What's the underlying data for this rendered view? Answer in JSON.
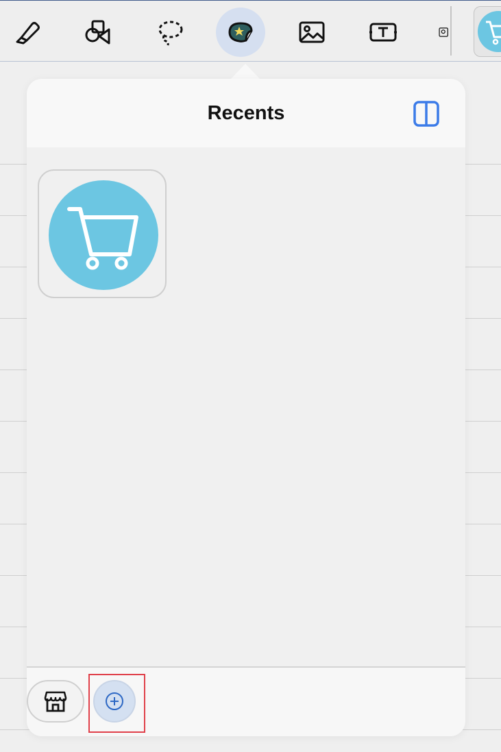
{
  "toolbar": {
    "tools": [
      {
        "name": "highlighter-tool",
        "icon": "highlighter-icon"
      },
      {
        "name": "shapes-tool",
        "icon": "shapes-icon"
      },
      {
        "name": "lasso-tool",
        "icon": "lasso-icon"
      },
      {
        "name": "stickers-tool",
        "icon": "sticker-icon",
        "active": true
      },
      {
        "name": "image-tool",
        "icon": "image-icon"
      },
      {
        "name": "text-tool",
        "icon": "text-box-icon"
      },
      {
        "name": "camera-tool",
        "icon": "camera-image-icon"
      }
    ],
    "recent_sticker_icon": "shopping-cart-icon"
  },
  "popover": {
    "title": "Recents",
    "panel_toggle_icon": "split-view-icon",
    "stickers": [
      {
        "icon": "shopping-cart-icon",
        "color": "#6cc6e2"
      }
    ],
    "footer": {
      "store_icon": "storefront-icon",
      "add_icon": "plus-circle-icon"
    }
  },
  "colors": {
    "accent": "#3b7be8",
    "active_tool_bg": "#d5dff0",
    "sticker_blue": "#6cc6e2",
    "highlight": "#e0404a"
  }
}
